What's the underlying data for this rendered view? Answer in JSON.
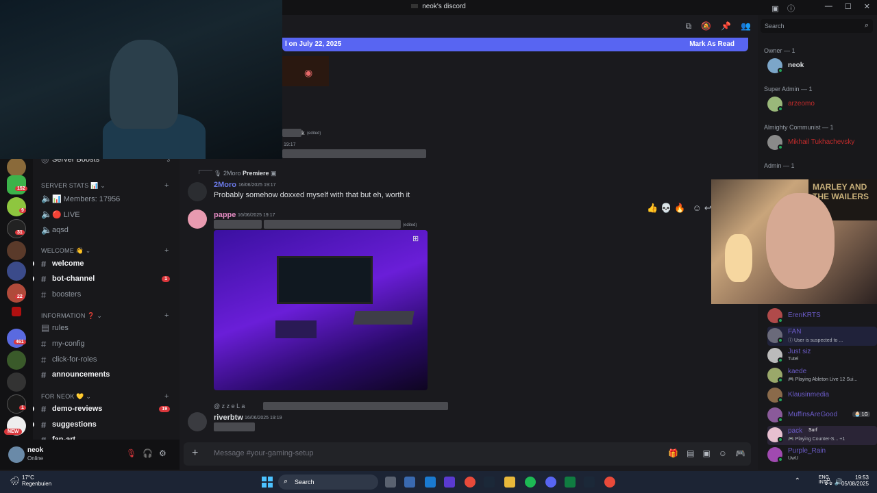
{
  "window": {
    "title": "neok's discord"
  },
  "banner": {
    "text": "l on July 22, 2025",
    "mark_read": "Mark As Read"
  },
  "sidebar": {
    "partial_top": "Server Boosts",
    "partial_top_count": "3",
    "categories": [
      {
        "label": "SERVER STATS 📊"
      },
      {
        "label": "WELCOME 👋"
      },
      {
        "label": "INFORMATION ❓"
      },
      {
        "label": "FOR NEOK 💛"
      }
    ],
    "channels": [
      {
        "label": "📊 Members:  17956"
      },
      {
        "label": "🔴 LIVE"
      },
      {
        "label": "aqsd"
      },
      {
        "label": "welcome"
      },
      {
        "label": "bot-channel",
        "count": "1"
      },
      {
        "label": "boosters"
      },
      {
        "label": "rules"
      },
      {
        "label": "my-config"
      },
      {
        "label": "click-for-roles"
      },
      {
        "label": "announcements"
      },
      {
        "label": "demo-reviews",
        "count": "19"
      },
      {
        "label": "suggestions"
      },
      {
        "label": "fan-art"
      }
    ]
  },
  "rail": {
    "badges": [
      "152",
      "9",
      "31",
      "22",
      "461",
      "1"
    ],
    "new_label": "NEW"
  },
  "user": {
    "name": "neok",
    "status": "Online"
  },
  "messages": [
    {
      "partial_name": "k",
      "edited": "(edited)",
      "time": "19:17"
    },
    {
      "reply_user": "2Moro",
      "reply_text": "Premiere",
      "author": "2Moro",
      "time": "16/06/2025 19:17",
      "text": "Probably somehow doxxed myself with that but eh, worth it"
    },
    {
      "author": "pappe",
      "time": "16/06/2025 19:17",
      "edited": "(edited)"
    },
    {
      "reply_user": "@ z z e L a",
      "author": "riverbtw",
      "time": "16/06/2025 19:19"
    }
  ],
  "composer": {
    "placeholder": "Message #your-gaming-setup"
  },
  "members": {
    "search_placeholder": "Search",
    "roles": [
      {
        "label": "Owner — 1"
      },
      {
        "label": "Super Admin — 1"
      },
      {
        "label": "Almighty Communist — 1"
      },
      {
        "label": "Admin — 1"
      }
    ],
    "list": [
      {
        "name": "neok",
        "color": "#f2f3f5"
      },
      {
        "name": "arzeomo",
        "color": "#c22b2b"
      },
      {
        "name": "Mikhail Tukhachevsky",
        "color": "#c22b2b"
      },
      {
        "name": "ErenKRTS",
        "color": "#6b5bc7"
      },
      {
        "name": "FAN",
        "color": "#6b5bc7",
        "sub": "ⓘ User is suspected to ..."
      },
      {
        "name": "Just siz",
        "color": "#6b5bc7",
        "sub": "Tutel"
      },
      {
        "name": "kaede",
        "color": "#6b5bc7",
        "sub": "🎮 Playing Ableton Live 12 Sui..."
      },
      {
        "name": "Klausinmedia",
        "color": "#6b5bc7"
      },
      {
        "name": "MuffinsAreGood",
        "color": "#6b5bc7",
        "sub": "",
        "tag": "🧁 1G"
      },
      {
        "name": "pack",
        "color": "#6b5bc7",
        "sub": "🎮 Playing Counter-S... +1",
        "tag": "Surf"
      },
      {
        "name": "Purple_Rain",
        "color": "#6b5bc7",
        "sub": "UwU"
      }
    ]
  },
  "cam2": {
    "poster": "MARLEY  AND THE WAILERS"
  },
  "taskbar": {
    "temp": "17°C",
    "weather": "Regenbuien",
    "search": "Search",
    "lang1": "ENG",
    "lang2": "INTL",
    "time": "19:53",
    "date": "05/08/2025"
  }
}
